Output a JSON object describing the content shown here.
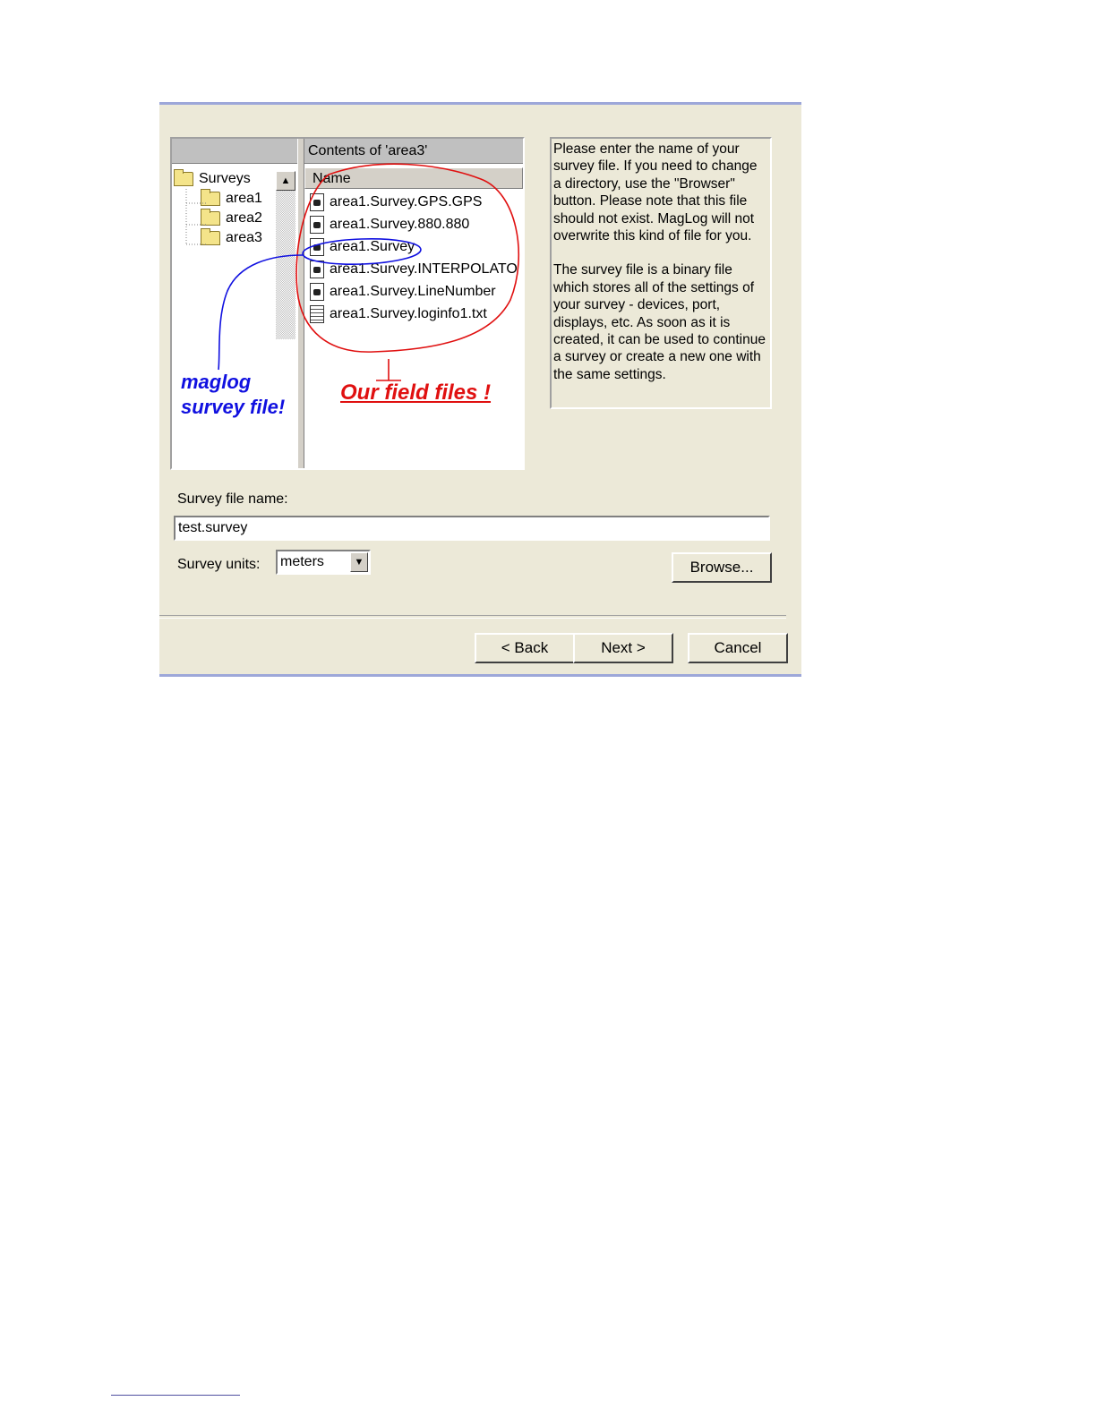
{
  "browser": {
    "contents_header": "Contents of 'area3'",
    "name_column": "Name",
    "tree": [
      {
        "label": "Surveys"
      },
      {
        "label": "area1"
      },
      {
        "label": "area2"
      },
      {
        "label": "area3"
      }
    ],
    "files": [
      {
        "name": "area1.Survey.GPS.GPS",
        "icon": "binary-file-icon"
      },
      {
        "name": "area1.Survey.880.880",
        "icon": "binary-file-icon"
      },
      {
        "name": "area1.Survey",
        "icon": "binary-file-icon"
      },
      {
        "name": "area1.Survey.INTERPOLATO",
        "icon": "binary-file-icon"
      },
      {
        "name": "area1.Survey.LineNumber",
        "icon": "binary-file-icon"
      },
      {
        "name": "area1.Survey.loginfo1.txt",
        "icon": "text-file-icon"
      }
    ]
  },
  "annotations": {
    "blue_line1": "maglog",
    "blue_line2": "survey file!",
    "red": "Our field files !",
    "blue_color": "#1010E0",
    "red_color": "#E01010"
  },
  "description": {
    "para1": "Please enter the name of your survey file. If you need to change a directory, use the \"Browser\" button. Please note that this file should not exist. MagLog will not overwrite this kind of file for you.",
    "para2": "The survey file is a binary file which stores all of the settings of your survey - devices, port, displays, etc. As soon as it is created, it can be used to continue a survey or create a new one with the same settings."
  },
  "form": {
    "file_label": "Survey file name:",
    "file_value": "test.survey",
    "units_label": "Survey units:",
    "units_value": "meters",
    "browse_label": "Browse..."
  },
  "buttons": {
    "back": "< Back",
    "next": "Next >",
    "cancel": "Cancel"
  }
}
